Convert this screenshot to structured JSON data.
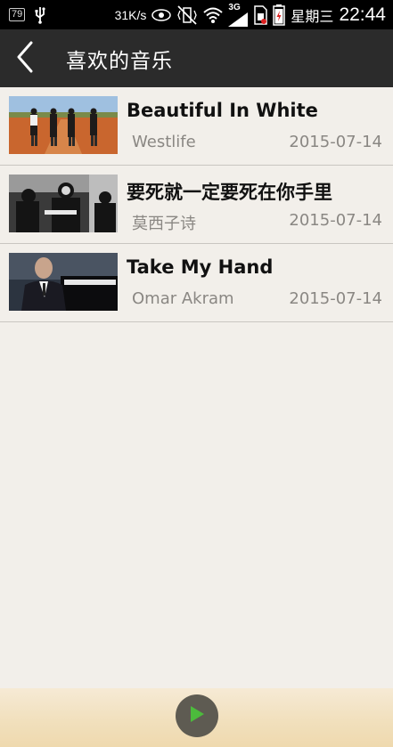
{
  "status_bar": {
    "battery_badge": "79",
    "net_speed": "31K/s",
    "network_type": "3G",
    "carrier": "星期三",
    "time": "22:44"
  },
  "header": {
    "title": "喜欢的音乐"
  },
  "songs": [
    {
      "title": "Beautiful In White",
      "artist": "Westlife",
      "date": "2015-07-14"
    },
    {
      "title": "要死就一定要死在你手里",
      "artist": "莫西子诗",
      "date": "2015-07-14"
    },
    {
      "title": "Take My Hand",
      "artist": "Omar Akram",
      "date": "2015-07-14"
    }
  ],
  "colors": {
    "title_bar": "#2b2b2b",
    "background": "#f2efea",
    "play_button": "#5e5b52",
    "play_icon": "#4cbb3c"
  },
  "icons": {
    "back": "chevron-left-icon",
    "play": "play-icon"
  }
}
